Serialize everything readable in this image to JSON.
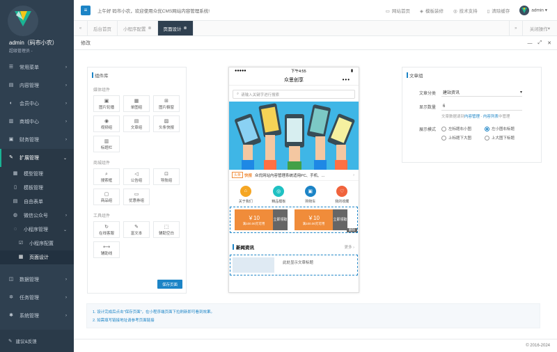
{
  "sidebar": {
    "user_name": "admin（码市小农）",
    "user_role": "超级管理员 -",
    "menu": [
      {
        "label": "常用菜单",
        "icon": "list-icon"
      },
      {
        "label": "内容管理",
        "icon": "book-icon"
      },
      {
        "label": "会员中心",
        "icon": "users-icon"
      },
      {
        "label": "商城中心",
        "icon": "cart-icon"
      },
      {
        "label": "财务管理",
        "icon": "money-icon"
      },
      {
        "label": "扩展管理",
        "icon": "edit-icon"
      }
    ],
    "ext_sub": [
      {
        "label": "模型管理",
        "icon": "grid-icon"
      },
      {
        "label": "模板管理",
        "icon": "file-icon"
      },
      {
        "label": "自由表单",
        "icon": "table-icon"
      },
      {
        "label": "微信公众号",
        "icon": "wechat-icon"
      },
      {
        "label": "小程序管理",
        "icon": "chat-icon"
      }
    ],
    "mini_sub": [
      {
        "label": "小程序配置",
        "icon": "check-icon"
      },
      {
        "label": "页面设计",
        "icon": "calendar-icon"
      }
    ],
    "menu_bottom": [
      {
        "label": "数据管理",
        "icon": "database-icon"
      },
      {
        "label": "任务管理",
        "icon": "cogs-icon"
      },
      {
        "label": "系统管理",
        "icon": "cog-icon"
      }
    ],
    "footer_label": "建议&反馈"
  },
  "topbar": {
    "welcome": "上午好 码市小农，欢迎使用众优CMS网站内容管理系统!",
    "links": [
      "网站首页",
      "模板装修",
      "技术支持",
      "清除缓存"
    ],
    "user": "admin"
  },
  "tabs": {
    "items": [
      "后台首页",
      "小程序配置",
      "页面设计"
    ],
    "close_ops": "关闭操作"
  },
  "page": {
    "title": "修改"
  },
  "library": {
    "title": "组件库",
    "sections": [
      {
        "title": "媒体组件",
        "items": [
          {
            "label": "图片轮播",
            "glyph": "▣"
          },
          {
            "label": "单图组",
            "glyph": "▦"
          },
          {
            "label": "图片橱窗",
            "glyph": "⊞"
          },
          {
            "label": "视频组",
            "glyph": "◉"
          },
          {
            "label": "文章组",
            "glyph": "▤"
          },
          {
            "label": "头条快报",
            "glyph": "▨"
          },
          {
            "label": "标题栏",
            "glyph": "▥"
          }
        ]
      },
      {
        "title": "商城组件",
        "items": [
          {
            "label": "搜索框",
            "glyph": "⌕"
          },
          {
            "label": "公告组",
            "glyph": "◁"
          },
          {
            "label": "导航组",
            "glyph": "⊡"
          },
          {
            "label": "商品组",
            "glyph": "▢"
          },
          {
            "label": "优惠券组",
            "glyph": "▭"
          }
        ]
      },
      {
        "title": "工具组件",
        "items": [
          {
            "label": "在线客服",
            "glyph": "↻"
          },
          {
            "label": "富文本",
            "glyph": "✎"
          },
          {
            "label": "辅助空白",
            "glyph": "⬚"
          },
          {
            "label": "辅助线",
            "glyph": "⟷"
          }
        ]
      }
    ],
    "save_label": "保存页面"
  },
  "phone": {
    "signal": "●●●●●",
    "time": "下午4:55",
    "battery": "▮",
    "nav_title": "众思创享",
    "search_placeholder": "请输入关键字进行搜索",
    "notice_tag1": "头条",
    "notice_tag2": "快报",
    "notice_text": "众优网站内容管理系统适用PC、手机、...",
    "quick": [
      {
        "label": "关于我们",
        "color": "#f5a623"
      },
      {
        "label": "精品模板",
        "color": "#1fc1c3"
      },
      {
        "label": "购物车",
        "color": "#1c84c6"
      },
      {
        "label": "我的收藏",
        "color": "#f0633c"
      }
    ],
    "coupons": [
      {
        "amount": "￥10",
        "cond": "满100.00元可用",
        "action": "立即领取"
      },
      {
        "amount": "￥10",
        "cond": "满100.00元可用",
        "action": "立即领取"
      }
    ],
    "del_label": "删除",
    "news_title": "新闻资讯",
    "news_more": "更多 ›",
    "article_title": "此处显示文章标题"
  },
  "settings": {
    "title": "文章组",
    "category_label": "文章分类",
    "category_value": "建站资讯",
    "count_label": "显示数量",
    "count_value": "6",
    "hint_pre": "文章数据请到",
    "hint_link1": "内容管理",
    "hint_sep": " - ",
    "hint_link2": "内容列表",
    "hint_post": "中管理",
    "mode_label": "展示模式",
    "modes": [
      "左标题右小图",
      "左小图右标题",
      "上标题下大图",
      "上大图下标题"
    ]
  },
  "tips": {
    "line1": "1. 设计完成后点击\"保存页面\"，在小程序端页面下拉刷新即可看到效果。",
    "line2": "2. 如需填写链接地址请参考页面链接"
  },
  "footer": {
    "copyright": "© 2016-2024"
  }
}
